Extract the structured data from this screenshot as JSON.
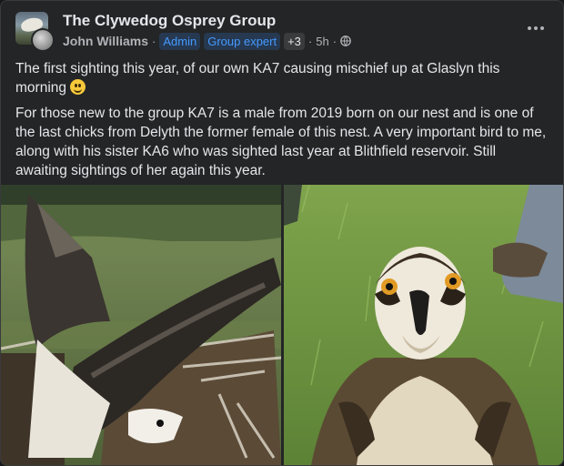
{
  "post": {
    "group_name": "The Clywedog Osprey Group",
    "author": "John Williams",
    "badges": [
      "Admin",
      "Group expert",
      "+3"
    ],
    "time": "5h",
    "privacy_icon": "globe-icon",
    "more_icon": "more-options-icon",
    "paragraphs": [
      "The first sighting this year, of our own KA7 causing mischief up at Glaslyn this morning",
      "For those new to the group KA7 is a male from 2019 born on our nest and is one of the last chicks from Delyth the former female of this nest. A very important bird to me, along with his sister KA6 who was sighted last year at Blithfield reservoir. Still awaiting sightings of her again this year."
    ],
    "emoji": "grinning-face-emoji"
  },
  "colors": {
    "card_bg": "#242526",
    "text": "#e4e6eb",
    "secondary_text": "#b0b3b8",
    "badge_text": "#4599ff",
    "badge_bg": "#263951"
  }
}
